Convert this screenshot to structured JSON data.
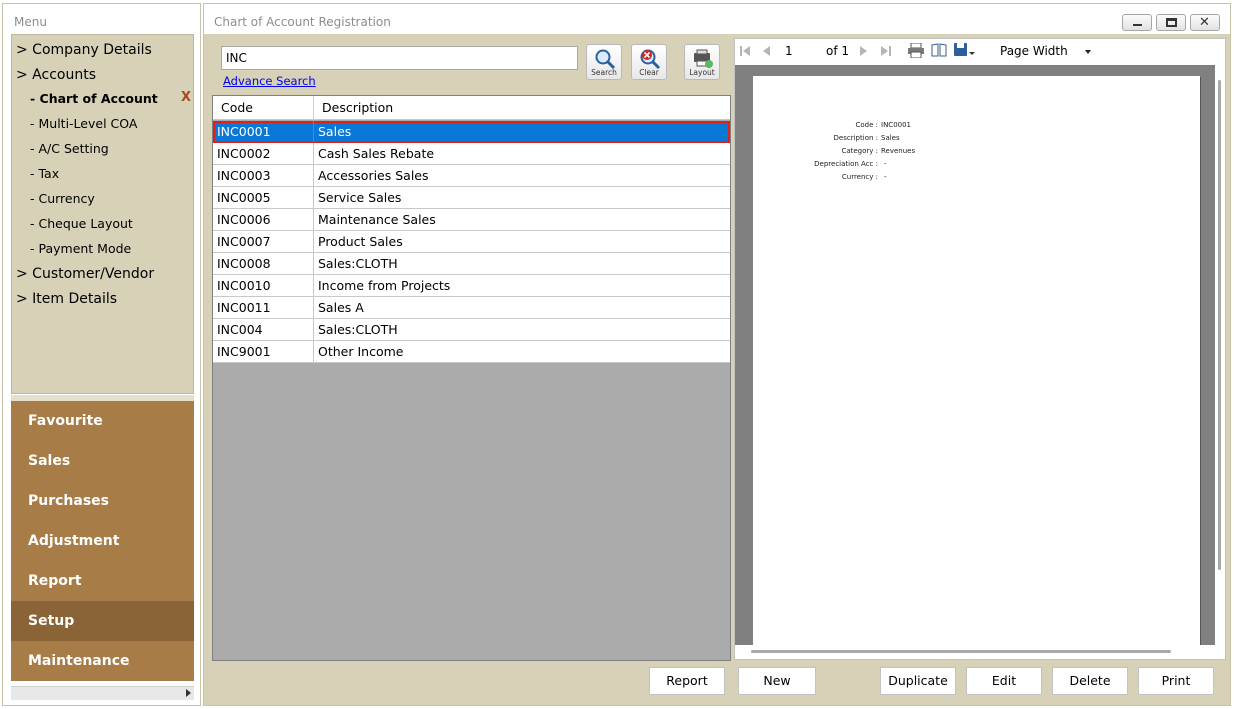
{
  "menu": {
    "title": "Menu",
    "tree": [
      {
        "label": "> Company Details",
        "level": "top"
      },
      {
        "label": "> Accounts",
        "level": "top"
      },
      {
        "label": "- Chart of Account",
        "level": "sub",
        "active": true
      },
      {
        "label": "- Multi-Level COA",
        "level": "sub"
      },
      {
        "label": "- A/C Setting",
        "level": "sub"
      },
      {
        "label": "- Tax",
        "level": "sub"
      },
      {
        "label": "- Currency",
        "level": "sub"
      },
      {
        "label": "- Cheque Layout",
        "level": "sub"
      },
      {
        "label": "- Payment Mode",
        "level": "sub"
      },
      {
        "label": "> Customer/Vendor",
        "level": "top"
      },
      {
        "label": "> Item Details",
        "level": "top"
      }
    ],
    "close_mark": "X",
    "categories": [
      "Favourite",
      "Sales",
      "Purchases",
      "Adjustment",
      "Report",
      "Setup",
      "Maintenance"
    ],
    "active_category": "Setup"
  },
  "window": {
    "title": "Chart of Account Registration"
  },
  "search": {
    "value": "INC",
    "advance_link": "Advance Search",
    "buttons": {
      "search": "Search",
      "clear": "Clear",
      "layout": "Layout"
    }
  },
  "grid": {
    "columns": [
      "Code",
      "Description"
    ],
    "rows": [
      {
        "code": "INC0001",
        "description": "Sales",
        "selected": true
      },
      {
        "code": "INC0002",
        "description": "Cash Sales Rebate"
      },
      {
        "code": "INC0003",
        "description": "Accessories Sales"
      },
      {
        "code": "INC0005",
        "description": "Service Sales"
      },
      {
        "code": "INC0006",
        "description": "Maintenance Sales"
      },
      {
        "code": "INC0007",
        "description": "Product Sales"
      },
      {
        "code": "INC0008",
        "description": "Sales:CLOTH"
      },
      {
        "code": "INC0010",
        "description": "Income from Projects"
      },
      {
        "code": "INC0011",
        "description": "Sales A"
      },
      {
        "code": "INC004",
        "description": "Sales:CLOTH"
      },
      {
        "code": "INC9001",
        "description": "Other Income"
      }
    ]
  },
  "viewer": {
    "page": "1",
    "of_text": "of  1",
    "zoom": "Page Width",
    "report": [
      {
        "label": "Code :",
        "value": "INC0001"
      },
      {
        "label": "Description :",
        "value": "Sales"
      },
      {
        "label": "Category :",
        "value": "Revenues"
      },
      {
        "label": "Depreciation Acc :",
        "value": "-"
      },
      {
        "label": "Currency :",
        "value": "-"
      }
    ]
  },
  "actions": [
    "Report",
    "New",
    "Duplicate",
    "Edit",
    "Delete",
    "Print"
  ],
  "colors": {
    "panel": "#d6d1b7",
    "category": "#a87c46",
    "category_active": "#8a6336",
    "selection": "#0a78d7",
    "selection_outline": "#e0201c",
    "link": "#0000ee"
  }
}
